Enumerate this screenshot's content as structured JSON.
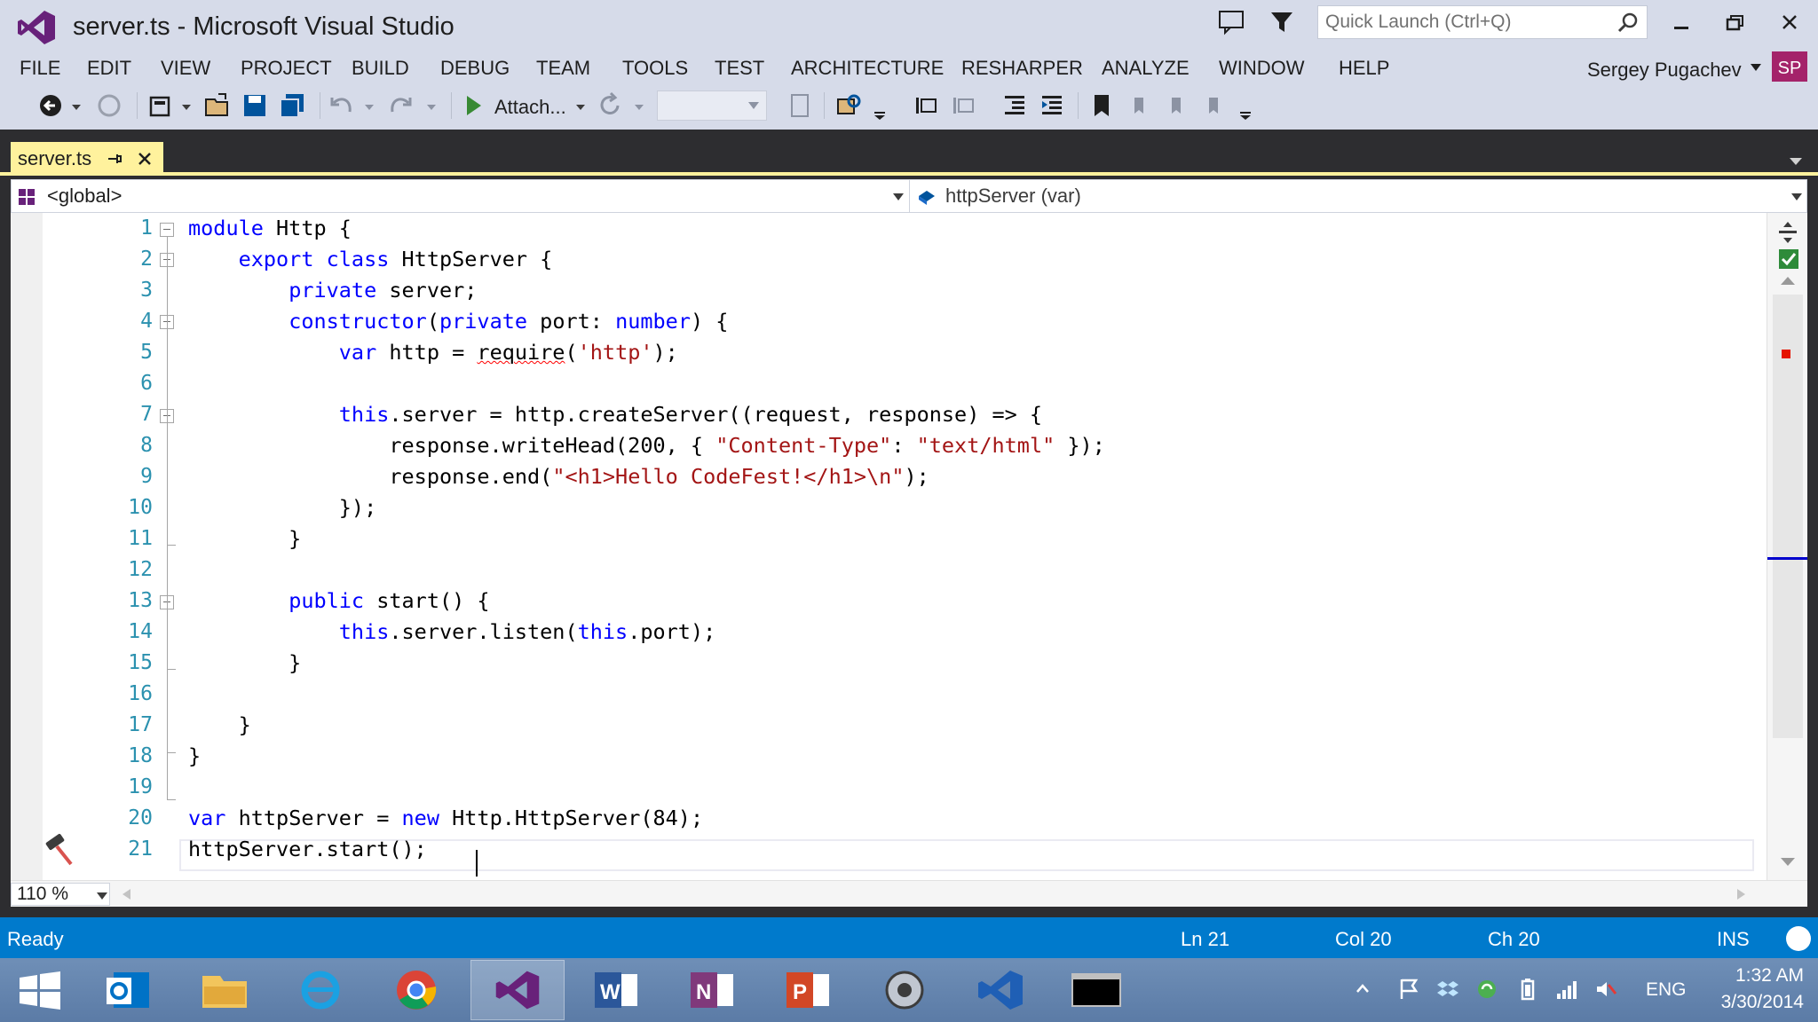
{
  "window": {
    "title": "server.ts - Microsoft Visual Studio",
    "quick_launch_placeholder": "Quick Launch (Ctrl+Q)"
  },
  "menu": [
    "FILE",
    "EDIT",
    "VIEW",
    "PROJECT",
    "BUILD",
    "DEBUG",
    "TEAM",
    "TOOLS",
    "TEST",
    "ARCHITECTURE",
    "RESHARPER",
    "ANALYZE",
    "WINDOW",
    "HELP"
  ],
  "user": {
    "name": "Sergey Pugachev",
    "initials": "SP"
  },
  "toolbar": {
    "attach_label": "Attach...",
    "start_icon": "play-icon"
  },
  "tabs": [
    {
      "label": "server.ts",
      "active": true
    }
  ],
  "navbar": {
    "scope": "<global>",
    "member": "httpServer (var)"
  },
  "editor": {
    "zoom": "110 %",
    "line_numbers": [
      "1",
      "2",
      "3",
      "4",
      "5",
      "6",
      "7",
      "8",
      "9",
      "10",
      "11",
      "12",
      "13",
      "14",
      "15",
      "16",
      "17",
      "18",
      "19",
      "20",
      "21"
    ],
    "lines": [
      [
        [
          "kw",
          "module"
        ],
        [
          "t",
          " Http {"
        ]
      ],
      [
        [
          "t",
          "    "
        ],
        [
          "kw",
          "export"
        ],
        [
          "t",
          " "
        ],
        [
          "kw",
          "class"
        ],
        [
          "t",
          " HttpServer {"
        ]
      ],
      [
        [
          "t",
          "        "
        ],
        [
          "kw",
          "private"
        ],
        [
          "t",
          " server;"
        ]
      ],
      [
        [
          "t",
          "        "
        ],
        [
          "kw",
          "constructor"
        ],
        [
          "t",
          "("
        ],
        [
          "kw",
          "private"
        ],
        [
          "t",
          " port: "
        ],
        [
          "kw",
          "number"
        ],
        [
          "t",
          ") {"
        ]
      ],
      [
        [
          "t",
          "            "
        ],
        [
          "kw",
          "var"
        ],
        [
          "t",
          " http = "
        ],
        [
          "sq",
          "require"
        ],
        [
          "t",
          "("
        ],
        [
          "str",
          "'http'"
        ],
        [
          "t",
          ");"
        ]
      ],
      [
        [
          "t",
          ""
        ]
      ],
      [
        [
          "t",
          "            "
        ],
        [
          "kw",
          "this"
        ],
        [
          "t",
          ".server = http.createServer((request, response) => {"
        ]
      ],
      [
        [
          "t",
          "                response.writeHead(200, { "
        ],
        [
          "str",
          "\"Content-Type\""
        ],
        [
          "t",
          ": "
        ],
        [
          "str",
          "\"text/html\""
        ],
        [
          "t",
          " });"
        ]
      ],
      [
        [
          "t",
          "                response.end("
        ],
        [
          "str",
          "\"<h1>Hello CodeFest!</h1>\\n\""
        ],
        [
          "t",
          ");"
        ]
      ],
      [
        [
          "t",
          "            });"
        ]
      ],
      [
        [
          "t",
          "        }"
        ]
      ],
      [
        [
          "t",
          ""
        ]
      ],
      [
        [
          "t",
          "        "
        ],
        [
          "kw",
          "public"
        ],
        [
          "t",
          " start() {"
        ]
      ],
      [
        [
          "t",
          "            "
        ],
        [
          "kw",
          "this"
        ],
        [
          "t",
          ".server.listen("
        ],
        [
          "kw",
          "this"
        ],
        [
          "t",
          ".port);"
        ]
      ],
      [
        [
          "t",
          "        }"
        ]
      ],
      [
        [
          "t",
          ""
        ]
      ],
      [
        [
          "t",
          "    }"
        ]
      ],
      [
        [
          "t",
          "}"
        ]
      ],
      [
        [
          "t",
          ""
        ]
      ],
      [
        [
          "kw",
          "var"
        ],
        [
          "t",
          " httpServer = "
        ],
        [
          "kw",
          "new"
        ],
        [
          "t",
          " Http.HttpServer(84);"
        ]
      ],
      [
        [
          "t",
          "httpServer.start();"
        ]
      ]
    ]
  },
  "status": {
    "state": "Ready",
    "line": "Ln 21",
    "col": "Col 20",
    "ch": "Ch 20",
    "mode": "INS"
  },
  "taskbar": {
    "apps": [
      "start-icon",
      "outlook-icon",
      "file-explorer-icon",
      "internet-explorer-icon",
      "chrome-icon",
      "visual-studio-icon",
      "word-icon",
      "onenote-icon",
      "powerpoint-icon",
      "network-tool-icon",
      "vs-alt-icon",
      "console-icon"
    ],
    "language": "ENG",
    "time": "1:32 AM",
    "date": "3/30/2014"
  },
  "colors": {
    "accent": "#007acc",
    "tab_active": "#fff29d",
    "vs_purple": "#68217a",
    "keyword": "#0000ff",
    "string": "#a31515",
    "line_number": "#2b91af"
  }
}
